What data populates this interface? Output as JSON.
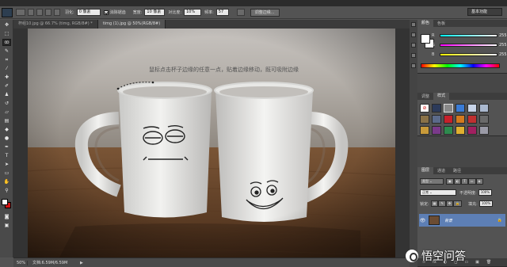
{
  "options_bar": {
    "feather_label": "羽化:",
    "feather_value": "0 像素",
    "antialias_label": "消除锯齿",
    "width_label": "宽度:",
    "width_value": "10 像素",
    "contrast_label": "对比度:",
    "contrast_value": "10%",
    "frequency_label": "频率:",
    "frequency_value": "57",
    "refine_edge_label": "调整边缘...",
    "workspace_label": "基本功能"
  },
  "document_tabs": [
    {
      "label": "杯组10.jpg @ 66.7% (timg, RGB/8#) *"
    },
    {
      "label": "timg (1).jpg @ 50%(RGB/8#)"
    }
  ],
  "canvas": {
    "annotation": "鼠标点击杯子边缘的任意一点，贴着边缘移动，既可吸附边缘"
  },
  "status_bar": {
    "zoom": "50%",
    "doc_info": "文档:6.59M/6.59M",
    "arrow": "▶"
  },
  "color_panel": {
    "tabs": [
      "颜色",
      "色板"
    ],
    "r_label": "R",
    "r_value": "255",
    "g_label": "G",
    "g_value": "255",
    "b_label": "B",
    "b_value": "255",
    "foreground": "#ffffff",
    "background": "#ffffff"
  },
  "adjustments_panel": {
    "tabs": [
      "调整",
      "样式"
    ]
  },
  "layers_panel": {
    "tabs": [
      "图层",
      "通道",
      "路径"
    ],
    "kind_label": "类型",
    "blend_mode": "正常",
    "opacity_label": "不透明度:",
    "opacity_value": "100%",
    "lock_label": "锁定:",
    "fill_label": "填充:",
    "fill_value": "100%",
    "layer_name": "背景",
    "bottom_icons": [
      "fx",
      "◐",
      "◻",
      "▭",
      "▣",
      "🗑"
    ]
  },
  "watermark": {
    "text": "悟空问答"
  },
  "colors": {
    "accent_selection": "#5d7fb5",
    "foreground_swatch": "#ffffff",
    "background_swatch": "#d21414"
  },
  "icons": {
    "tools": [
      "move-tool",
      "marquee-tool",
      "lasso-tool",
      "quick-select-tool",
      "crop-tool",
      "eyedropper-tool",
      "healing-brush-tool",
      "brush-tool",
      "clone-stamp-tool",
      "history-brush-tool",
      "eraser-tool",
      "gradient-tool",
      "blur-tool",
      "dodge-tool",
      "pen-tool",
      "type-tool",
      "path-select-tool",
      "shape-tool",
      "hand-tool",
      "zoom-tool"
    ]
  }
}
